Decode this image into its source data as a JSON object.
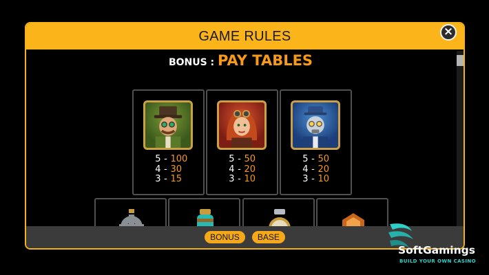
{
  "modal": {
    "title": "GAME RULES",
    "close_icon": "close-icon",
    "subtitle_prefix": "BONUS : ",
    "subtitle_main": "PAY TABLES"
  },
  "paytable": {
    "symbols": [
      {
        "name": "steampunk-gentleman-symbol",
        "pays": [
          {
            "count": "5",
            "dash": "-",
            "value": "100"
          },
          {
            "count": "4",
            "dash": "-",
            "value": "30"
          },
          {
            "count": "3",
            "dash": "-",
            "value": "15"
          }
        ]
      },
      {
        "name": "steampunk-lady-symbol",
        "pays": [
          {
            "count": "5",
            "dash": "-",
            "value": "50"
          },
          {
            "count": "4",
            "dash": "-",
            "value": "20"
          },
          {
            "count": "3",
            "dash": "-",
            "value": "10"
          }
        ]
      },
      {
        "name": "steampunk-robot-symbol",
        "pays": [
          {
            "count": "5",
            "dash": "-",
            "value": "50"
          },
          {
            "count": "4",
            "dash": "-",
            "value": "20"
          },
          {
            "count": "3",
            "dash": "-",
            "value": "10"
          }
        ]
      }
    ],
    "small_symbols": [
      "gear-icon",
      "potion-bottle-icon",
      "pocket-watch-icon",
      "shield-badge-icon"
    ]
  },
  "footer": {
    "buttons": [
      {
        "label": "BONUS"
      },
      {
        "label": "BASE"
      }
    ]
  },
  "brand": {
    "name": "SoftGamings",
    "tagline": "BUILD YOUR OWN CASINO"
  },
  "colors": {
    "accent": "#fbb41a",
    "value_orange": "#f79a1a",
    "footer_bg": "#3b3b3b",
    "brand_teal": "#2fd0c8"
  }
}
